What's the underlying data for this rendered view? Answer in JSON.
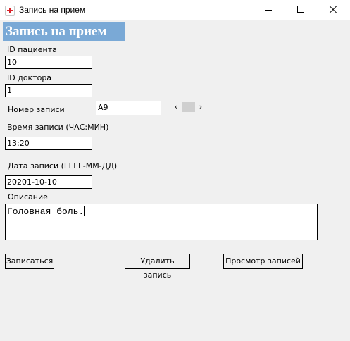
{
  "window": {
    "title": "Запись на прием",
    "icon": "red-cross-icon"
  },
  "form": {
    "header": "Запись на прием",
    "patient_id": {
      "label": "ID пациента",
      "value": "10"
    },
    "doctor_id": {
      "label": "ID доктора",
      "value": "1"
    },
    "record_number": {
      "label": "Номер записи",
      "value": "А9",
      "prev": "‹",
      "next": "›"
    },
    "time": {
      "label": "Время записи (ЧАС:МИН)",
      "value": "13:20"
    },
    "date": {
      "label": "Дата записи (ГГГГ-ММ-ДД)",
      "value": "20201-10-10"
    },
    "description": {
      "label": "Описание",
      "value": "Головная боль."
    }
  },
  "buttons": {
    "register": "Записаться",
    "delete": "Удалить запись",
    "view": "Просмотр записей"
  },
  "colors": {
    "header_bg": "#7aa9d6",
    "window_bg": "#f0f0f0"
  }
}
